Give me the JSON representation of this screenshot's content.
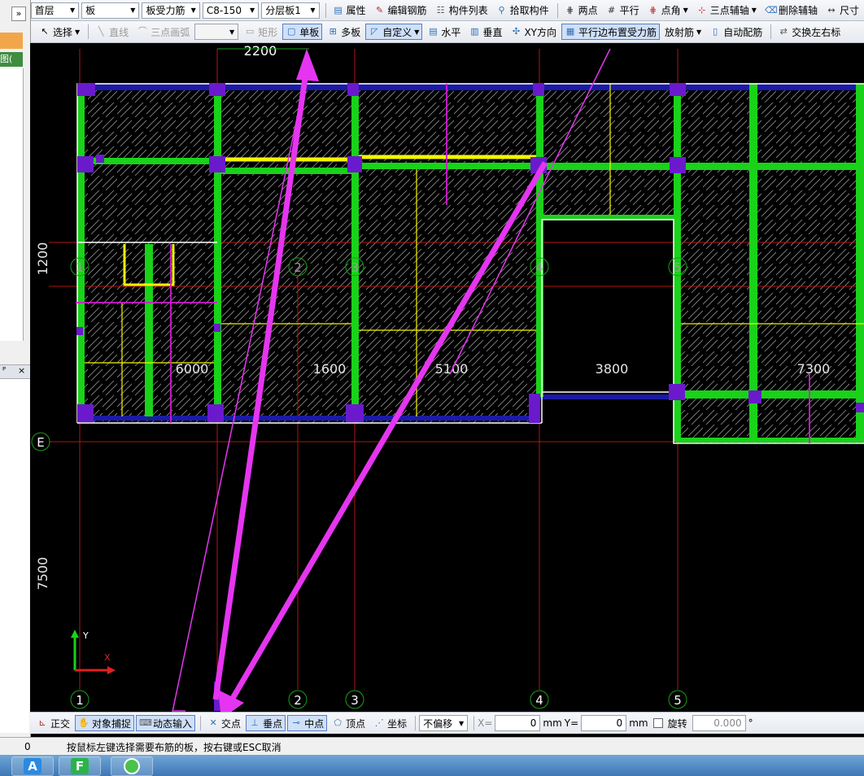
{
  "toolbar1": {
    "floor": "首层",
    "component_type": "板",
    "rebar_type": "板受力筋",
    "rebar_spec": "C8-150",
    "layer": "分层板1",
    "property": "属性",
    "edit_rebar": "编辑钢筋",
    "component_list": "构件列表",
    "pick_component": "拾取构件",
    "two_point": "两点",
    "parallel": "平行",
    "point_angle": "点角",
    "three_point_axis": "三点辅轴",
    "delete_axis": "删除辅轴",
    "dimension": "尺寸"
  },
  "toolbar2": {
    "select": "选择",
    "line": "直线",
    "three_point_arc": "三点画弧",
    "rect": "矩形",
    "single_board": "单板",
    "multi_board": "多板",
    "custom": "自定义",
    "horizontal": "水平",
    "vertical": "垂直",
    "xy_direction": "XY方向",
    "parallel_edge": "平行边布置受力筋",
    "radial": "放射筋",
    "auto_rebar": "自动配筋",
    "swap_marks": "交换左右标"
  },
  "left_panel": {
    "more": "»",
    "tab_fragment": "图(",
    "pin": "ᴾ",
    "close": "×"
  },
  "canvas": {
    "dimensions": {
      "top_span": "2200",
      "left_upper": "1200",
      "left_lower": "7500",
      "bay1": "6000",
      "bay2": "1600",
      "bay3": "5100",
      "bay4": "3800",
      "bay5": "7300"
    },
    "axis_labels": [
      "1",
      "2",
      "3",
      "4",
      "5"
    ],
    "row_label": "E",
    "ucs_x": "X",
    "ucs_y": "Y"
  },
  "bottom_toolbar": {
    "ortho": "正交",
    "snap": "对象捕捉",
    "dynamic_input": "动态输入",
    "intersection": "交点",
    "perpendicular": "垂点",
    "midpoint": "中点",
    "vertex": "顶点",
    "coordinate": "坐标",
    "offset_mode": "不偏移",
    "x_label": "X=",
    "x_value": "0",
    "y_label": "Y=",
    "y_value": "0",
    "unit": "mm",
    "rotate": "旋转",
    "rotate_value": "0.000",
    "degree": "°"
  },
  "status_bar": {
    "left_value": "0",
    "message": "按鼠标左键选择需要布筋的板，按右键或ESC取消"
  },
  "colors": {
    "beam": "#19d219",
    "slab_edge": "#1a1aa8",
    "column": "#6a1acc",
    "rebar_yellow": "#f5f500",
    "rebar_magenta": "#d21ad2",
    "axis_red": "#b41414",
    "arrow": "#e535f0",
    "axis_circle": "#18a018"
  }
}
